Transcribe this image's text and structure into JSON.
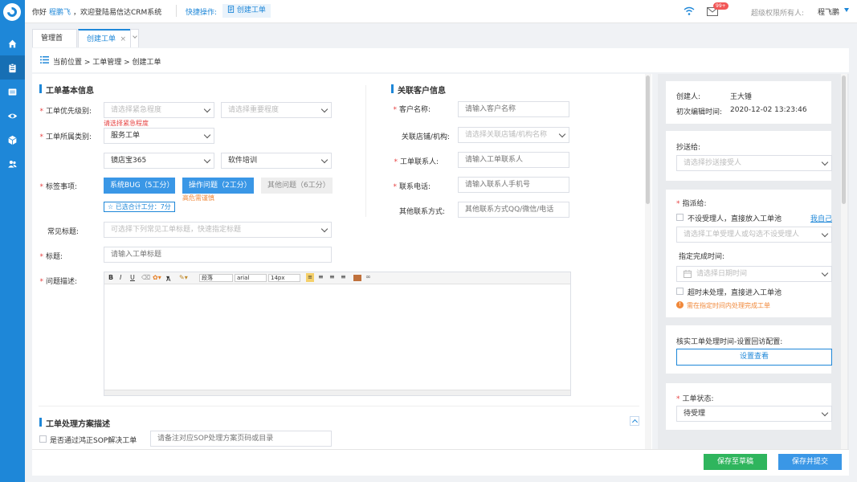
{
  "header": {
    "greeting": "你好",
    "username": "程鹏飞",
    "welcome": "，欢迎登陆易信达CRM系统",
    "quick_label": "快捷操作:",
    "quick_button": "创建工单",
    "badge": "99+",
    "owner_label": "超级权限所有人:",
    "owner_name": "程飞鹏"
  },
  "sidebar": {
    "items": [
      {
        "icon": "home-icon"
      },
      {
        "icon": "clipboard-icon"
      },
      {
        "icon": "list-icon"
      },
      {
        "icon": "eye-icon"
      },
      {
        "icon": "box-icon"
      },
      {
        "icon": "users-icon"
      }
    ]
  },
  "tabs": [
    {
      "label": "管理首页"
    },
    {
      "label": "创建工单",
      "close": "×"
    }
  ],
  "breadcrumb": "当前位置 > 工单管理 > 创建工单",
  "basic": {
    "title": "工单基本信息",
    "priority_label": "工单优先级别:",
    "priority_urgency_placeholder": "请选择紧急程度",
    "priority_importance_placeholder": "请选择重要程度",
    "priority_error": "请选择紧急程度",
    "category_label": "工单所属类别:",
    "category_value": "服务工单",
    "product_value": "镜店宝365",
    "subtype_value": "软件培训",
    "tags_label": "标签事项:",
    "tags": [
      {
        "label": "系统BUG（5工分）",
        "active": true
      },
      {
        "label": "操作问题（2工分）",
        "active": true
      },
      {
        "label": "其他问题（6工分）",
        "active": false
      }
    ],
    "tag_note": "高危需谨慎",
    "selected_points": "已选合计工分：7分",
    "common_title_label": "常见标题:",
    "common_title_placeholder": "可选择下列常见工单标题，快速指定标题",
    "title_label": "标题:",
    "title_placeholder": "请输入工单标题",
    "desc_label": "问题描述:"
  },
  "editor": {
    "bold": "B",
    "italic": "I",
    "underline": "U",
    "font_color": "A",
    "paragraph": "段落",
    "font": "arial",
    "size": "14px"
  },
  "customer": {
    "title": "关联客户信息",
    "name_label": "客户名称:",
    "name_placeholder": "请输入客户名称",
    "store_label": "关联店铺/机构:",
    "store_placeholder": "请选择关联店铺/机构名称",
    "contact_label": "工单联系人:",
    "contact_placeholder": "请输入工单联系人",
    "phone_label": "联系电话:",
    "phone_placeholder": "请输入联系人手机号",
    "other_label": "其他联系方式:",
    "other_placeholder": "其他联系方式QQ/微信/电话"
  },
  "solution": {
    "title": "工单处理方案描述",
    "sop_label": "是否通过鸿正SOP解决工单",
    "sop_placeholder": "请备注对应SOP处理方案页码或目录"
  },
  "right": {
    "creator_label": "创建人:",
    "creator_value": "王大锤",
    "edit_time_label": "初次编辑时间:",
    "edit_time_value": "2020-12-02  13:23:46",
    "cc_label": "抄送给:",
    "cc_placeholder": "请选择抄送接受人",
    "assign_label": "指派给:",
    "no_assignee_label": "不设受理人，直接放入工单池",
    "assign_self": "我自己",
    "assignee_placeholder": "请选择工单受理人或勾选不设受理人",
    "deadline_label": "指定完成时间:",
    "date_placeholder": "请选择日期时间",
    "overdue_label": "超时未处理，直接进入工单池",
    "deadline_hint": "需在指定时间内处理完成工单",
    "verify_label": "核实工单处理时间-设置回访配置:",
    "verify_button": "设置查看",
    "status_label": "工单状态:",
    "status_value": "待受理"
  },
  "footer": {
    "save_draft": "保存至草稿",
    "save_submit": "保存并提交"
  },
  "colors": {
    "primary": "#1e87d8",
    "draft_button": "#2fb55d",
    "error": "#e64242",
    "warning": "#f0883a"
  }
}
